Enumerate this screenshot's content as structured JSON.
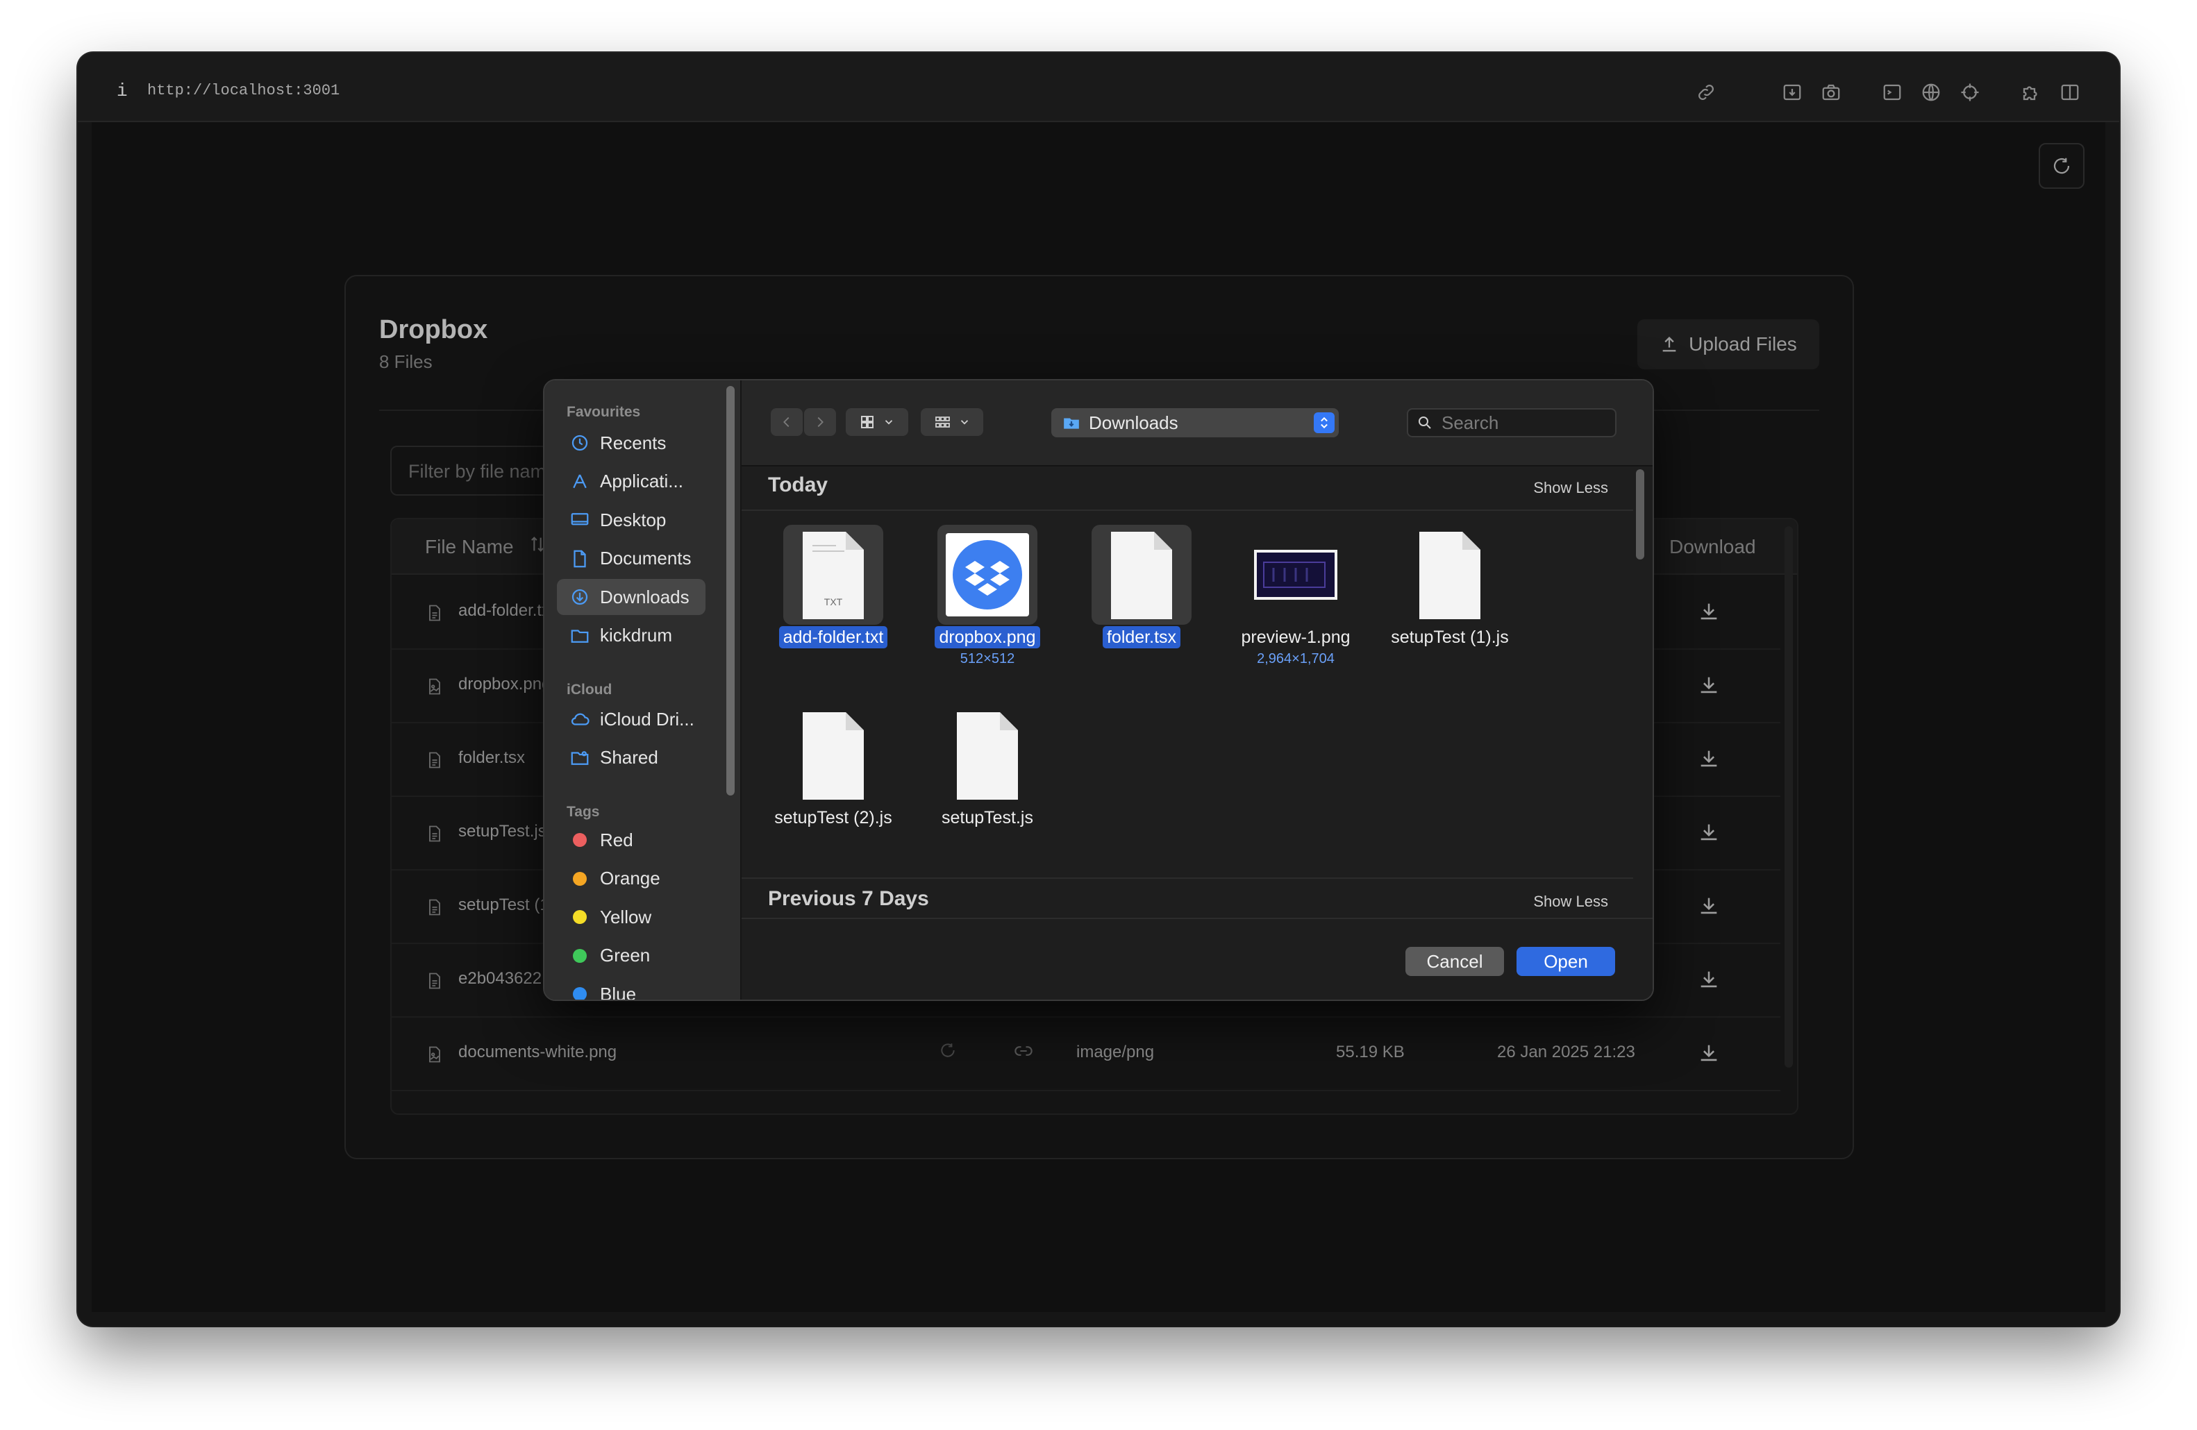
{
  "browser": {
    "info_glyph": "i",
    "url": "http://localhost:3001",
    "toolbar_icons": [
      "link-icon",
      "download-box-icon",
      "camera-icon",
      "terminal-icon",
      "globe-icon",
      "crosshair-icon",
      "puzzle-icon",
      "split-view-icon"
    ],
    "refresh_icon": "refresh-icon"
  },
  "app": {
    "title": "Dropbox",
    "subtitle": "8 Files",
    "upload_label": "Upload Files",
    "filter_placeholder": "Filter by file name...",
    "columns": {
      "file_name": "File Name",
      "download": "Download"
    },
    "rows": [
      {
        "name": "add-folder.txt",
        "icon": "document-icon"
      },
      {
        "name": "dropbox.png",
        "icon": "image-file-icon"
      },
      {
        "name": "folder.tsx",
        "icon": "document-icon"
      },
      {
        "name": "setupTest.js",
        "icon": "document-icon"
      },
      {
        "name": "setupTest (1).js",
        "icon": "document-icon"
      },
      {
        "name": "e2b043622",
        "icon": "document-icon"
      },
      {
        "name": "documents-white.png",
        "icon": "image-file-icon",
        "type": "image/png",
        "size": "55.19 KB",
        "date": "26 Jan 2025 21:23"
      }
    ]
  },
  "dialog": {
    "sidebar": {
      "favourites_label": "Favourites",
      "favourites": [
        {
          "label": "Recents",
          "icon": "clock-icon"
        },
        {
          "label": "Applicati...",
          "icon": "applications-icon"
        },
        {
          "label": "Desktop",
          "icon": "desktop-icon"
        },
        {
          "label": "Documents",
          "icon": "document-icon"
        },
        {
          "label": "Downloads",
          "icon": "download-circle-icon",
          "selected": true
        },
        {
          "label": "kickdrum",
          "icon": "folder-icon"
        }
      ],
      "icloud_label": "iCloud",
      "icloud": [
        {
          "label": "iCloud Dri...",
          "icon": "cloud-icon"
        },
        {
          "label": "Shared",
          "icon": "shared-folder-icon"
        }
      ],
      "tags_label": "Tags",
      "tags": [
        {
          "label": "Red",
          "color": "#ec5f5f"
        },
        {
          "label": "Orange",
          "color": "#f5a623"
        },
        {
          "label": "Yellow",
          "color": "#f5dd27"
        },
        {
          "label": "Green",
          "color": "#3fc85a"
        },
        {
          "label": "Blue",
          "color": "#2f8cf0"
        }
      ]
    },
    "location": "Downloads",
    "search_placeholder": "Search",
    "groups": [
      {
        "title": "Today",
        "toggle": "Show Less"
      },
      {
        "title": "Previous 7 Days",
        "toggle": "Show Less"
      }
    ],
    "files": [
      {
        "name": "add-folder.txt",
        "kind": "txt",
        "selected": true,
        "badge": "TXT"
      },
      {
        "name": "dropbox.png",
        "kind": "dropbox",
        "selected": true,
        "dims": "512×512"
      },
      {
        "name": "folder.tsx",
        "kind": "blank",
        "selected": true
      },
      {
        "name": "preview-1.png",
        "kind": "preview",
        "selected": false,
        "dims": "2,964×1,704"
      },
      {
        "name": "setupTest (1).js",
        "kind": "blank",
        "selected": false
      },
      {
        "name": "setupTest (2).js",
        "kind": "blank",
        "selected": false
      },
      {
        "name": "setupTest.js",
        "kind": "blank",
        "selected": false
      }
    ],
    "cancel_label": "Cancel",
    "open_label": "Open"
  }
}
